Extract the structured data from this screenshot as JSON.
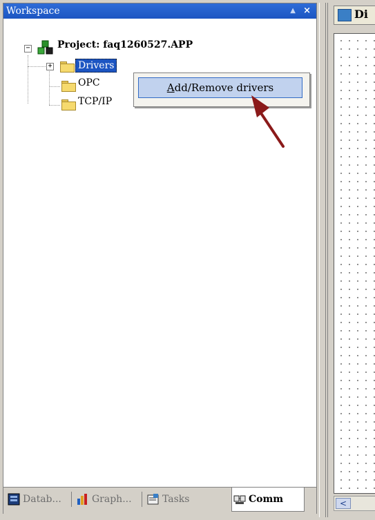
{
  "workspace": {
    "title": "Workspace",
    "pin_label": "▲",
    "close_label": "×",
    "tree": {
      "project_label": "Project: faq1260527.APP",
      "project_expander": "−",
      "drivers_label": "Drivers",
      "drivers_expander": "+",
      "opc_label": "OPC",
      "tcpip_label": "TCP/IP"
    },
    "context_menu": {
      "item_prefix": "A",
      "item_rest": "dd/Remove drivers"
    },
    "tabs": [
      "Datab...",
      "Graph...",
      "Tasks",
      "Comm"
    ],
    "active_tab": "Comm"
  },
  "document": {
    "tab_title": "Di",
    "scroll_left_label": "<"
  },
  "colors": {
    "title_bar": "#1c55c2",
    "arrow": "#8b1a1a",
    "selection": "#1c55c2",
    "menu_highlight": "#c1d2ee"
  },
  "icons": {
    "project": "project-cubes-icon",
    "folder": "folder-icon",
    "database": "database-icon",
    "graphics": "graphics-icon",
    "tasks": "tasks-icon",
    "comm": "comm-icon",
    "document": "document-icon"
  }
}
